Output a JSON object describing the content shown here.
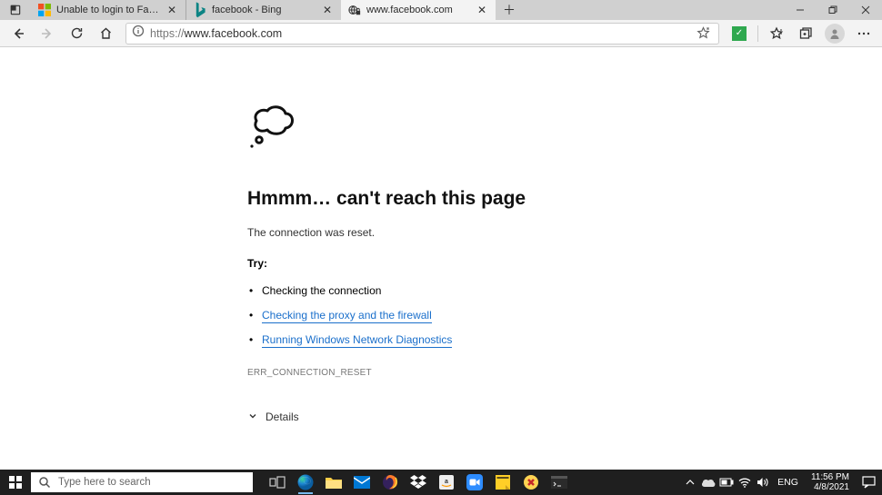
{
  "browser": {
    "tabs": [
      {
        "title": "Unable to login to Facebook thro...",
        "active": false
      },
      {
        "title": "facebook - Bing",
        "active": false
      },
      {
        "title": "www.facebook.com",
        "active": true
      }
    ],
    "url_scheme": "https://",
    "url_host": "www.facebook.com"
  },
  "error": {
    "title": "Hmmm… can't reach this page",
    "message": "The connection was reset.",
    "try_label": "Try:",
    "suggestions": [
      {
        "text": "Checking the connection",
        "link": false
      },
      {
        "text": "Checking the proxy and the firewall",
        "link": true
      },
      {
        "text": "Running Windows Network Diagnostics",
        "link": true
      }
    ],
    "code": "ERR_CONNECTION_RESET",
    "details_label": "Details"
  },
  "taskbar": {
    "search_placeholder": "Type here to search",
    "lang": "ENG",
    "clock_time": "11:56 PM",
    "clock_date": "4/8/2021"
  }
}
